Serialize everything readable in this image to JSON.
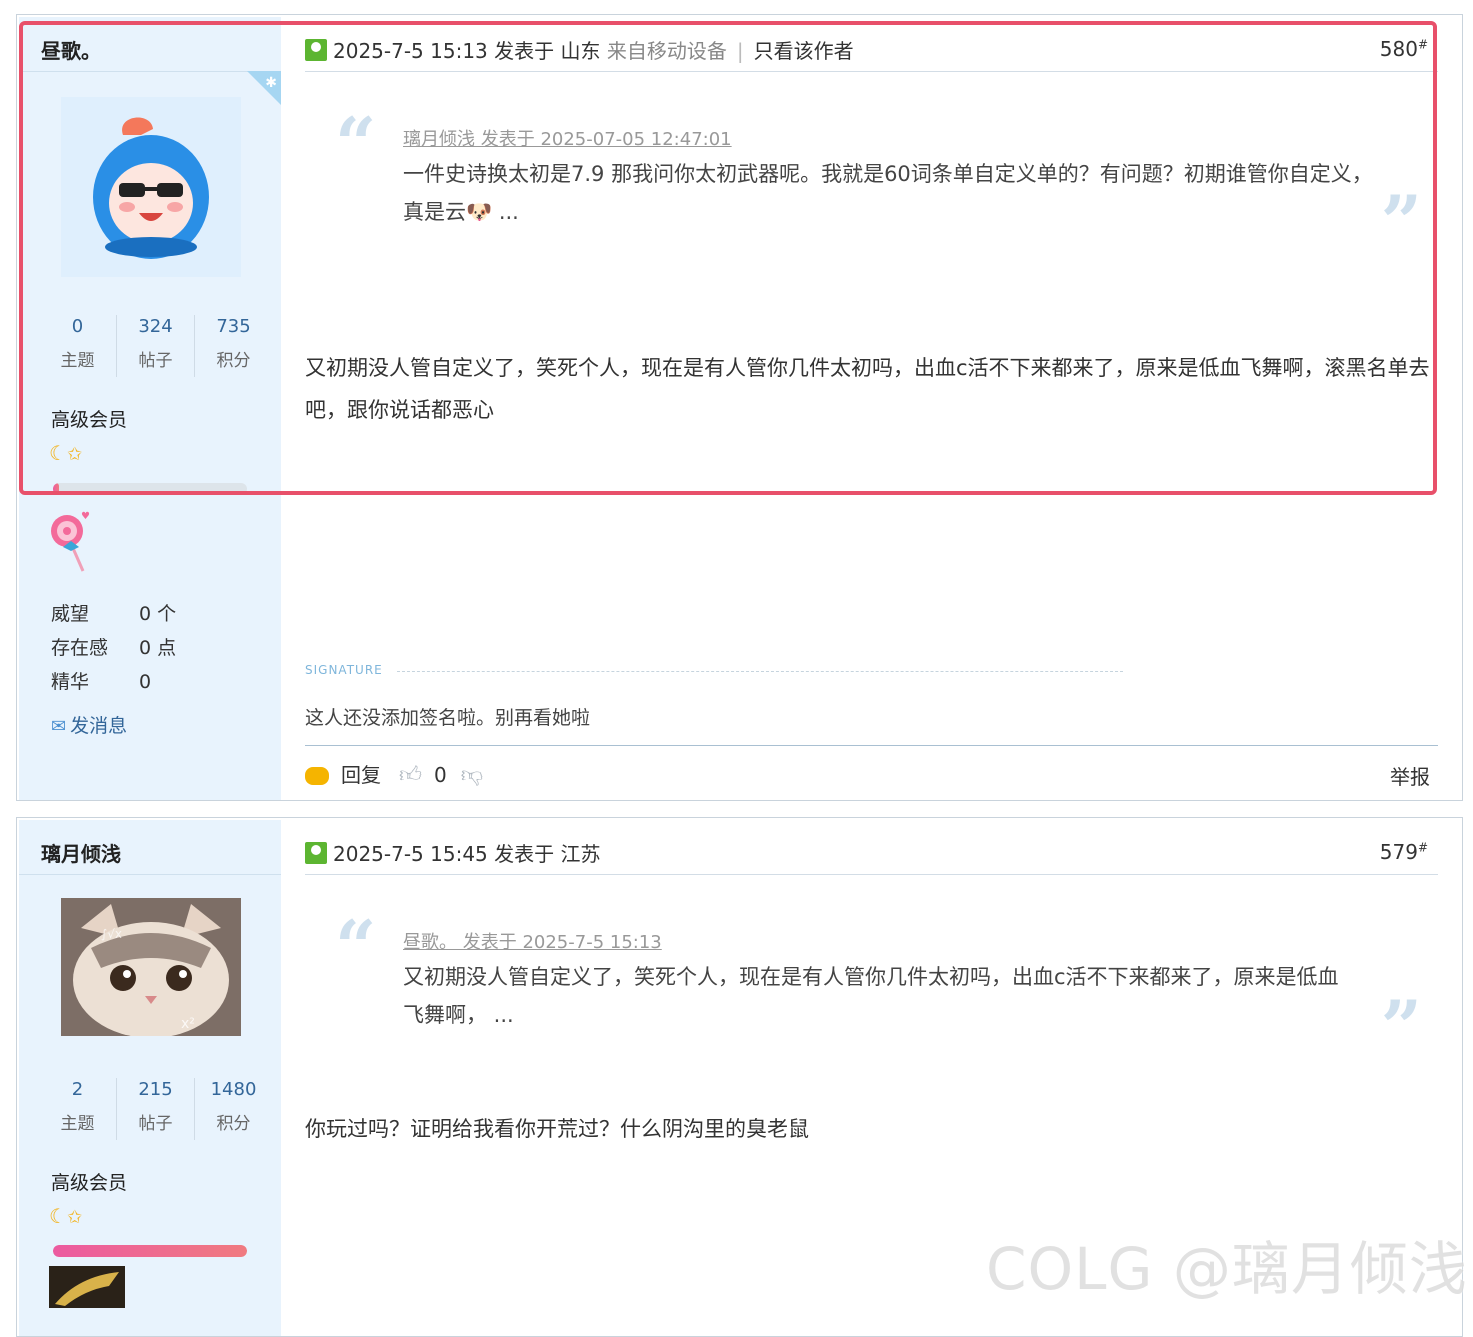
{
  "posts": [
    {
      "username": "昼歌。",
      "stats": [
        {
          "num": "0",
          "label": "主题"
        },
        {
          "num": "324",
          "label": "帖子"
        },
        {
          "num": "735",
          "label": "积分"
        }
      ],
      "group": "高级会员",
      "progress": 0.03,
      "info": [
        {
          "k": "威望",
          "v": "0 个"
        },
        {
          "k": "存在感",
          "v": "0 点"
        },
        {
          "k": "精华",
          "v": "0"
        }
      ],
      "send_msg": "发消息",
      "header": {
        "date": "2025-7-5 15:13",
        "posted_in": "发表于",
        "location": "山东",
        "device": "来自移动设备",
        "only_author": "只看该作者",
        "floor": "580"
      },
      "quote": {
        "author": "璃月倾浅 发表于 2025-07-05 12:47:01",
        "text": "一件史诗换太初是7.9 那我问你太初武器呢。我就是60词条单自定义单的？有问题？初期谁管你自定义，真是云🐶 ..."
      },
      "body": "又初期没人管自定义了，笑死个人，现在是有人管你几件太初吗，出血c活不下来都来了，原来是低血飞舞啊，滚黑名单去吧，跟你说话都恶心",
      "signature_label": "SIGNATURE",
      "signature": "这人还没添加签名啦。别再看她啦",
      "actions": {
        "reply": "回复",
        "likes": "0",
        "report": "举报"
      }
    },
    {
      "username": "璃月倾浅",
      "stats": [
        {
          "num": "2",
          "label": "主题"
        },
        {
          "num": "215",
          "label": "帖子"
        },
        {
          "num": "1480",
          "label": "积分"
        }
      ],
      "group": "高级会员",
      "progress": 1.0,
      "header": {
        "date": "2025-7-5 15:45",
        "posted_in": "发表于",
        "location": "江苏",
        "floor": "579"
      },
      "quote": {
        "author": "昼歌。 发表于 2025-7-5 15:13",
        "text": "又初期没人管自定义了，笑死个人，现在是有人管你几件太初吗，出血c活不下来都来了，原来是低血飞舞啊，  ..."
      },
      "body": "你玩过吗？证明给我看你开荒过？什么阴沟里的臭老鼠"
    }
  ],
  "watermark": "COLG @璃月倾浅",
  "colors": {
    "highlight": "#e8506a",
    "sidebar": "#e8f3fd",
    "link": "#336699"
  }
}
